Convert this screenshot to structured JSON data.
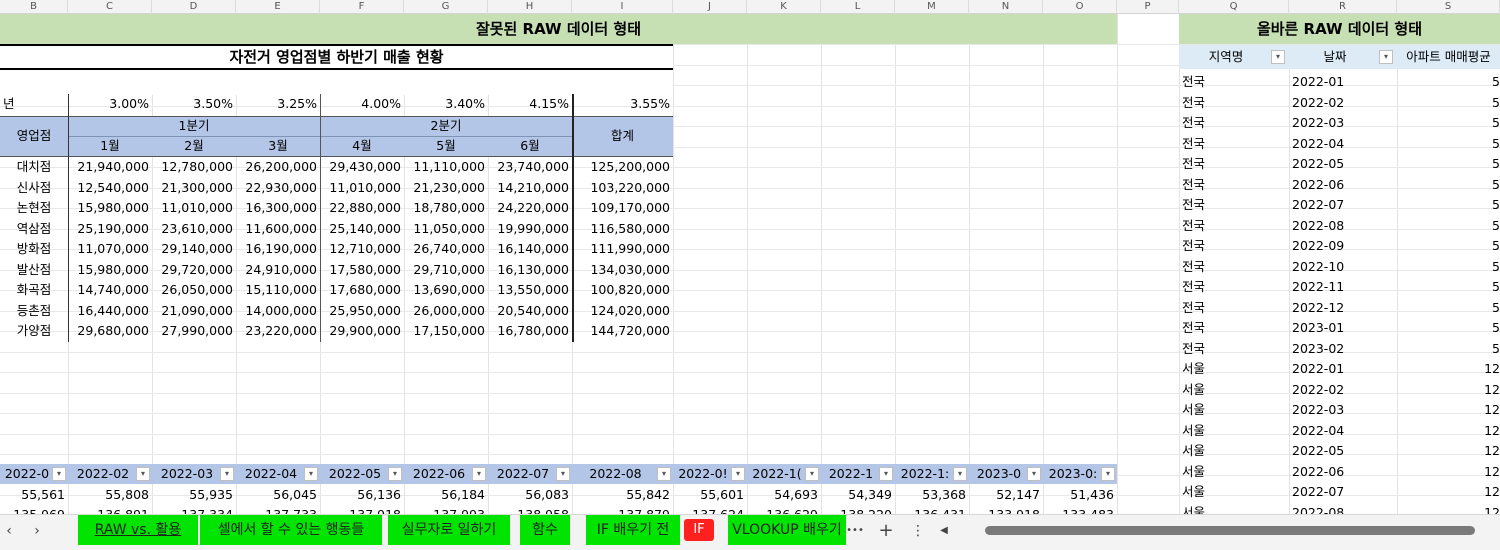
{
  "columns": [
    "B",
    "C",
    "D",
    "E",
    "F",
    "G",
    "H",
    "I",
    "J",
    "K",
    "L",
    "M",
    "N",
    "O",
    "P",
    "Q",
    "R",
    "S"
  ],
  "left": {
    "banner": "잘못된 RAW 데이터 형태",
    "title": "자전거 영업점별 하반기 매출 현황",
    "rate_label": "년",
    "rates": [
      "3.00%",
      "3.50%",
      "3.25%",
      "4.00%",
      "3.40%",
      "4.15%"
    ],
    "rate_total": "3.55%",
    "header": {
      "branch": "영업점",
      "q1": "1분기",
      "q2": "2분기",
      "months": [
        "1월",
        "2월",
        "3월",
        "4월",
        "5월",
        "6월"
      ],
      "total": "합계"
    },
    "rows": [
      [
        "대치점",
        "21,940,000",
        "12,780,000",
        "26,200,000",
        "29,430,000",
        "11,110,000",
        "23,740,000",
        "125,200,000"
      ],
      [
        "신사점",
        "12,540,000",
        "21,300,000",
        "22,930,000",
        "11,010,000",
        "21,230,000",
        "14,210,000",
        "103,220,000"
      ],
      [
        "논현점",
        "15,980,000",
        "11,010,000",
        "16,300,000",
        "22,880,000",
        "18,780,000",
        "24,220,000",
        "109,170,000"
      ],
      [
        "역삼점",
        "25,190,000",
        "23,610,000",
        "11,600,000",
        "25,140,000",
        "11,050,000",
        "19,990,000",
        "116,580,000"
      ],
      [
        "방화점",
        "11,070,000",
        "29,140,000",
        "16,190,000",
        "12,710,000",
        "26,740,000",
        "16,140,000",
        "111,990,000"
      ],
      [
        "발산점",
        "15,980,000",
        "29,720,000",
        "24,910,000",
        "17,580,000",
        "29,710,000",
        "16,130,000",
        "134,030,000"
      ],
      [
        "화곡점",
        "14,740,000",
        "26,050,000",
        "15,110,000",
        "17,680,000",
        "13,690,000",
        "13,550,000",
        "100,820,000"
      ],
      [
        "등촌점",
        "16,440,000",
        "21,090,000",
        "14,000,000",
        "25,950,000",
        "26,000,000",
        "20,540,000",
        "124,020,000"
      ],
      [
        "가양점",
        "29,680,000",
        "27,990,000",
        "23,220,000",
        "29,900,000",
        "17,150,000",
        "16,780,000",
        "144,720,000"
      ]
    ],
    "bottom_headers": [
      "2022-0",
      "2022-02",
      "2022-03",
      "2022-04",
      "2022-05",
      "2022-06",
      "2022-07",
      "2022-08",
      "2022-0!",
      "2022-1(",
      "2022-1",
      "2022-1:",
      "2023-0",
      "2023-0:"
    ],
    "bottom_values": [
      "55,561",
      "55,808",
      "55,935",
      "56,045",
      "56,136",
      "56,184",
      "56,083",
      "55,842",
      "55,601",
      "54,693",
      "54,349",
      "53,368",
      "52,147",
      "51,436"
    ],
    "bottom_partial": [
      "135,969",
      "136,891",
      "137,334",
      "137,733",
      "137,918",
      "137,993",
      "138,958",
      "137,879",
      "137,624",
      "136,629",
      "138,220",
      "136,431",
      "133,918",
      "133,483"
    ]
  },
  "right": {
    "banner": "올바른 RAW 데이터 형태",
    "headers": [
      "지역명",
      "날짜",
      "아파트 매매평균"
    ],
    "rows": [
      [
        "전국",
        "2022-01",
        "5"
      ],
      [
        "전국",
        "2022-02",
        "5"
      ],
      [
        "전국",
        "2022-03",
        "5"
      ],
      [
        "전국",
        "2022-04",
        "5"
      ],
      [
        "전국",
        "2022-05",
        "5"
      ],
      [
        "전국",
        "2022-06",
        "5"
      ],
      [
        "전국",
        "2022-07",
        "5"
      ],
      [
        "전국",
        "2022-08",
        "5"
      ],
      [
        "전국",
        "2022-09",
        "5"
      ],
      [
        "전국",
        "2022-10",
        "5"
      ],
      [
        "전국",
        "2022-11",
        "5"
      ],
      [
        "전국",
        "2022-12",
        "5"
      ],
      [
        "전국",
        "2023-01",
        "5"
      ],
      [
        "전국",
        "2023-02",
        "5"
      ],
      [
        "서울",
        "2022-01",
        "12"
      ],
      [
        "서울",
        "2022-02",
        "12"
      ],
      [
        "서울",
        "2022-03",
        "12"
      ],
      [
        "서울",
        "2022-04",
        "12"
      ],
      [
        "서울",
        "2022-05",
        "12"
      ],
      [
        "서울",
        "2022-06",
        "12"
      ],
      [
        "서울",
        "2022-07",
        "12"
      ],
      [
        "서울",
        "2022-08",
        "12"
      ]
    ]
  },
  "tabs": {
    "prev": "‹",
    "next": "›",
    "items": [
      "RAW vs. 활용",
      "셀에서 할 수 있는 행동들",
      "실무자로 일하기",
      "함수",
      "IF 배우기 전",
      "IF",
      "VLOOKUP 배우기"
    ],
    "more": "•••",
    "add": "+",
    "menu": "⋮",
    "scroll_left": "◀",
    "active_color": "#00e400",
    "if_color": "#ff2020"
  },
  "dropdown_glyph": "▾"
}
